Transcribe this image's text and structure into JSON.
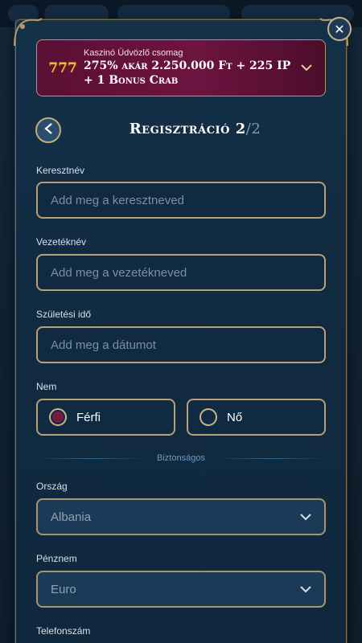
{
  "bonus": {
    "label": "Kaszinó Üdvözlő csomag",
    "offer_line1": "275% akár 2.250.000 Ft + 225 IP",
    "offer_line2": "+ 1 Bonus Crab",
    "icon": "777-slot-icon",
    "icon_text": "777"
  },
  "header": {
    "title": "Regisztráció 2",
    "step": "/2"
  },
  "form": {
    "first_name": {
      "label": "Keresztnév",
      "placeholder": "Add meg a keresztneved"
    },
    "last_name": {
      "label": "Vezetéknév",
      "placeholder": "Add meg a vezetékneved"
    },
    "birth_date": {
      "label": "Születési idő",
      "placeholder": "Add meg a dátumot"
    },
    "gender": {
      "label": "Nem",
      "options": [
        {
          "label": "Férfi",
          "selected": true
        },
        {
          "label": "Nő",
          "selected": false
        }
      ]
    },
    "divider": "Biztonságos",
    "country": {
      "label": "Ország",
      "value": "Albania"
    },
    "currency": {
      "label": "Pénznem",
      "value": "Euro"
    },
    "phone": {
      "label": "Telefonszám"
    }
  },
  "colors": {
    "accent_gold": "#b8a074",
    "bonus_bg": "#6d1440",
    "modal_bg": "#143148"
  }
}
